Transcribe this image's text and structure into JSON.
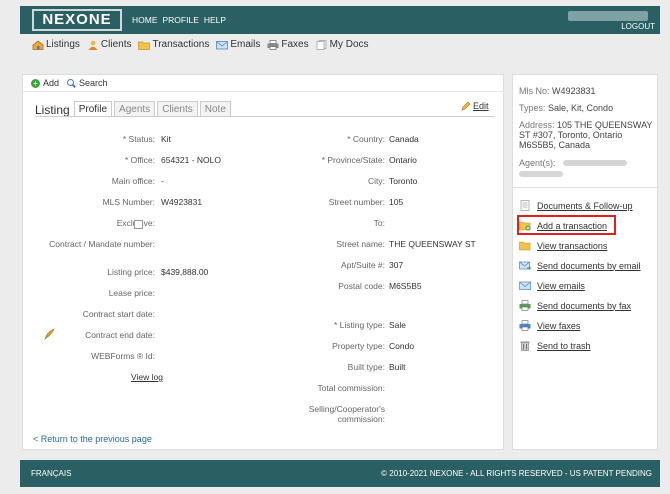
{
  "header": {
    "logo": "NEXONE",
    "nav": [
      "HOME",
      "PROFILE",
      "HELP"
    ],
    "logout": "LOGOUT"
  },
  "main_nav": [
    {
      "label": "Listings",
      "icon": "house-icon"
    },
    {
      "label": "Clients",
      "icon": "people-icon"
    },
    {
      "label": "Transactions",
      "icon": "folder-icon"
    },
    {
      "label": "Emails",
      "icon": "envelope-icon"
    },
    {
      "label": "Faxes",
      "icon": "printer-icon"
    },
    {
      "label": "My Docs",
      "icon": "documents-icon"
    }
  ],
  "toolbar": {
    "add": "Add",
    "search": "Search"
  },
  "tabs": {
    "title": "Listing",
    "items": [
      "Profile",
      "Agents",
      "Clients",
      "Note"
    ],
    "active": "Profile",
    "edit": "Edit"
  },
  "left_fields": [
    {
      "label": "* Status:",
      "value": "Kit"
    },
    {
      "label": "* Office:",
      "value": "654321 - NOLO"
    },
    {
      "label": "Main office:",
      "value": "-"
    },
    {
      "label": "MLS Number:",
      "value": "W4923831"
    },
    {
      "label": "Exclusive:",
      "value": ""
    },
    {
      "label": "Contract / Mandate number:",
      "value": ""
    },
    {
      "label": "Listing price:",
      "value": "$439,888.00"
    },
    {
      "label": "Lease price:",
      "value": ""
    },
    {
      "label": "Contract start date:",
      "value": ""
    },
    {
      "label": "Contract end date:",
      "value": ""
    },
    {
      "label": "WEBForms ® Id:",
      "value": ""
    }
  ],
  "view_log": "View log",
  "right_fields": [
    {
      "label": "* Country:",
      "value": "Canada"
    },
    {
      "label": "* Province/State:",
      "value": "Ontario"
    },
    {
      "label": "City:",
      "value": "Toronto"
    },
    {
      "label": "Street number:",
      "value": "105"
    },
    {
      "label": "To:",
      "value": ""
    },
    {
      "label": "Street name:",
      "value": "THE QUEENSWAY ST"
    },
    {
      "label": "Apt/Suite #:",
      "value": "307"
    },
    {
      "label": "Postal code:",
      "value": "M6S5B5"
    },
    {
      "label": "* Listing type:",
      "value": "Sale"
    },
    {
      "label": "Property type:",
      "value": "Condo"
    },
    {
      "label": "Built type:",
      "value": "Built"
    },
    {
      "label": "Total commission:",
      "value": ""
    },
    {
      "label": "Selling/Cooperator's commission:",
      "value": ""
    }
  ],
  "return_link": "< Return to the previous page",
  "sidebar": {
    "mls_label": "Mls No:",
    "mls_value": "W4923831",
    "types_label": "Types:",
    "types_value": "Sale, Kit, Condo",
    "address_label": "Address:",
    "address_value": "105 THE QUEENSWAY ST #307, Toronto, Ontario M6S5B5, Canada",
    "agents_label": "Agent(s):",
    "links": [
      {
        "label": "Documents & Follow-up",
        "icon": "document-icon"
      },
      {
        "label": "Add a transaction",
        "icon": "add-folder-icon"
      },
      {
        "label": "View transactions",
        "icon": "folder-icon"
      },
      {
        "label": "Send documents by email",
        "icon": "email-send-icon"
      },
      {
        "label": "View emails",
        "icon": "envelope-icon"
      },
      {
        "label": "Send documents by fax",
        "icon": "printer-icon"
      },
      {
        "label": "View faxes",
        "icon": "fax-icon"
      },
      {
        "label": "Send to trash",
        "icon": "trash-icon"
      }
    ]
  },
  "footer": {
    "language": "FRANÇAIS",
    "copyright": "© 2010-2021 NEXONE - ALL RIGHTS RESERVED - US PATENT PENDING"
  },
  "colors": {
    "brand": "#2a5f63",
    "link": "#2a6aa1",
    "highlight": "#e02020"
  }
}
